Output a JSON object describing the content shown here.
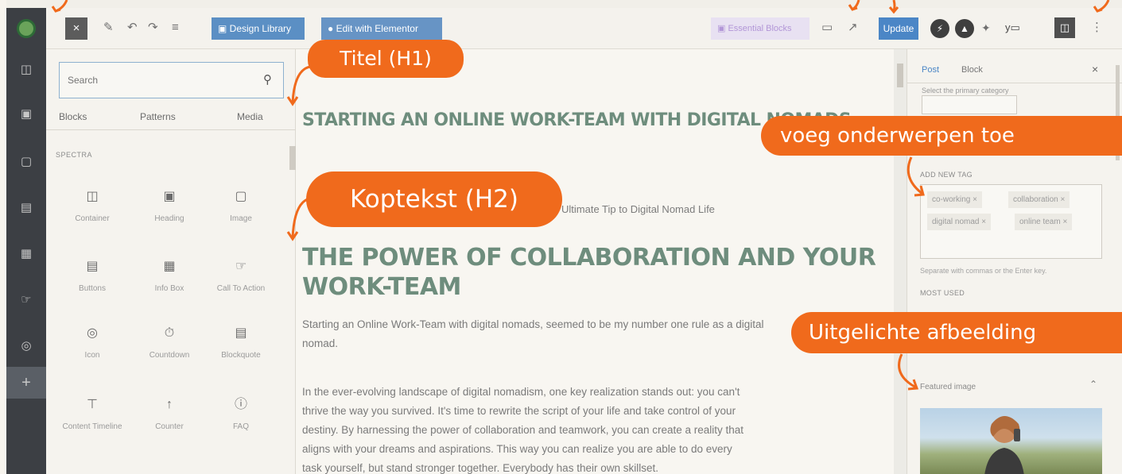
{
  "toolbar": {
    "close_label": "×",
    "design_library_label": "Design Library",
    "edit_elementor_label": "Edit with Elementor",
    "essential_blocks_label": "Essential Blocks",
    "update_label": "Update"
  },
  "inserter": {
    "search_placeholder": "Search",
    "tabs": [
      "Blocks",
      "Patterns",
      "Media"
    ],
    "section_title": "SPECTRA",
    "blocks": [
      {
        "label": "Container",
        "icon": "container-icon"
      },
      {
        "label": "Heading",
        "icon": "heading-icon"
      },
      {
        "label": "Image",
        "icon": "image-icon"
      },
      {
        "label": "Buttons",
        "icon": "buttons-icon"
      },
      {
        "label": "Info Box",
        "icon": "info-box-icon"
      },
      {
        "label": "Call To Action",
        "icon": "call-to-action-icon"
      },
      {
        "label": "Icon",
        "icon": "icon-block-icon"
      },
      {
        "label": "Countdown",
        "icon": "countdown-icon"
      },
      {
        "label": "Blockquote",
        "icon": "blockquote-icon"
      },
      {
        "label": "Content Timeline",
        "icon": "timeline-icon"
      },
      {
        "label": "Counter",
        "icon": "counter-icon"
      },
      {
        "label": "FAQ",
        "icon": "faq-icon"
      }
    ]
  },
  "editor": {
    "title": "STARTING AN ONLINE WORK-TEAM WITH DIGITAL NOMADS",
    "subheading": "Ultimate Tip to Digital Nomad Life",
    "h2": "THE POWER OF COLLABORATION AND YOUR WORK-TEAM",
    "para1": "Starting an Online Work-Team with digital nomads, seemed to be my number one rule as a digital nomad.",
    "para2_lines": [
      "In the ever-evolving landscape of digital nomadism, one key realization stands out: you can't",
      "thrive the way you survived. It's time to rewrite the script of your life and take control of your",
      "destiny. By harnessing the power of collaboration and teamwork, you can create a reality that",
      "aligns with your dreams and aspirations. This way you can realize you are able to do every",
      "task yourself, but stand stronger together. Everybody has their own skillset."
    ]
  },
  "settings": {
    "tabs": [
      "Post",
      "Block"
    ],
    "close_label": "×",
    "primary_category_label": "Select the primary category",
    "add_tag_label": "ADD NEW TAG",
    "tags": [
      "co-working ×",
      "collaboration ×",
      "digital nomad ×",
      "online team ×"
    ],
    "tag_hint": "Separate with commas or the Enter key.",
    "most_used_label": "MOST USED",
    "featured_image_label": "Featured image"
  },
  "callouts": {
    "title": "Titel (H1)",
    "heading": "Koptekst (H2)",
    "tags": "voeg onderwerpen toe",
    "featured": "Uitgelichte afbeelding"
  },
  "colors": {
    "callout": "#f06a1c",
    "heading_text": "#6e8d7d",
    "update_button": "#4b86c6"
  }
}
